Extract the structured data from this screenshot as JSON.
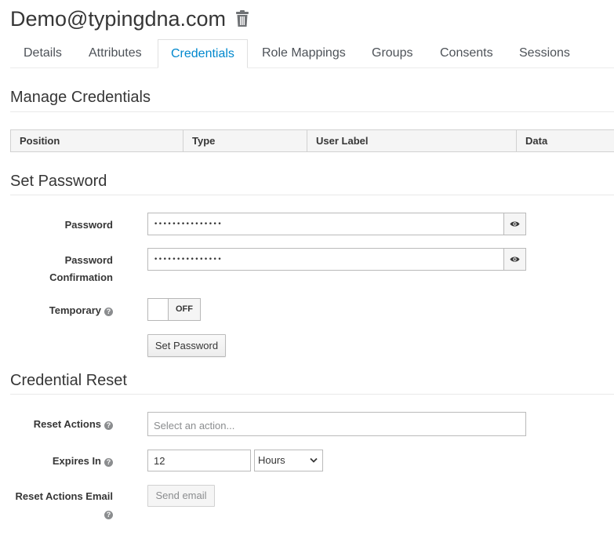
{
  "header": {
    "title": "Demo@typingdna.com",
    "delete_icon": "trash-icon"
  },
  "tabs": [
    {
      "label": "Details",
      "active": false
    },
    {
      "label": "Attributes",
      "active": false
    },
    {
      "label": "Credentials",
      "active": true
    },
    {
      "label": "Role Mappings",
      "active": false
    },
    {
      "label": "Groups",
      "active": false
    },
    {
      "label": "Consents",
      "active": false
    },
    {
      "label": "Sessions",
      "active": false
    }
  ],
  "manage": {
    "title": "Manage Credentials",
    "columns": [
      "Position",
      "Type",
      "User Label",
      "Data"
    ]
  },
  "set_password": {
    "title": "Set Password",
    "password_label": "Password",
    "password_value": "•••••••••••••••",
    "confirm_label_line1": "Password",
    "confirm_label_line2": "Confirmation",
    "confirm_value": "•••••••••••••••",
    "temporary_label": "Temporary",
    "temporary_state": "OFF",
    "set_button": "Set Password",
    "reveal_icon": "eye-icon"
  },
  "reset": {
    "title": "Credential Reset",
    "actions_label": "Reset Actions",
    "actions_placeholder": "Select an action...",
    "expires_label": "Expires In",
    "expires_value": "12",
    "expires_unit": "Hours",
    "email_label": "Reset Actions Email",
    "send_button": "Send email"
  },
  "colors": {
    "accent": "#0088ce",
    "text": "#363636",
    "border": "#bababa"
  }
}
